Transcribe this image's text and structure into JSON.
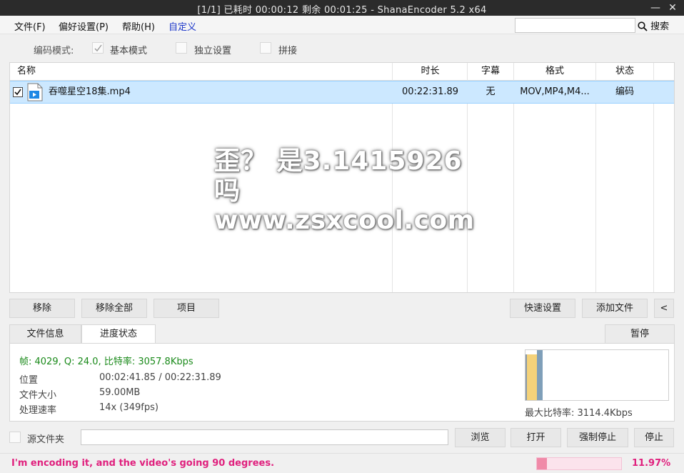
{
  "window": {
    "title": "[1/1] 已耗时 00:00:12  剩余 00:01:25 - ShanaEncoder 5.2 x64",
    "minimize_glyph": "—",
    "close_glyph": "✕"
  },
  "menu": {
    "items": [
      "文件(F)",
      "偏好设置(P)",
      "帮助(H)",
      "自定义"
    ],
    "search_placeholder": "",
    "search_label": "搜索"
  },
  "mode": {
    "label": "编码模式:",
    "options": [
      {
        "label": "基本模式",
        "checked": true
      },
      {
        "label": "独立设置",
        "checked": false
      },
      {
        "label": "拼接",
        "checked": false
      }
    ]
  },
  "file_list": {
    "columns": [
      "名称",
      "时长",
      "字幕",
      "格式",
      "状态"
    ],
    "rows": [
      {
        "checked": true,
        "name": "吞噬星空18集.mp4",
        "duration": "00:22:31.89",
        "subtitle": "无",
        "format": "MOV,MP4,M4...",
        "status": "编码"
      }
    ]
  },
  "watermark": {
    "line1": "歪？ 是3.1415926吗",
    "line2": "www.zsxcool.com"
  },
  "list_buttons": {
    "remove": "移除",
    "remove_all": "移除全部",
    "item": "项目",
    "quick_settings": "快速设置",
    "add_file": "添加文件",
    "collapse": "<"
  },
  "tabs": {
    "file_info": "文件信息",
    "progress": "进度状态",
    "pause": "暂停",
    "active": "progress"
  },
  "progress": {
    "stat_line": "帧: 4029, Q: 24.0, 比特率: 3057.8Kbps",
    "rows": [
      {
        "key": "位置",
        "value": "00:02:41.85 / 00:22:31.89"
      },
      {
        "key": "文件大小",
        "value": "59.00MB"
      },
      {
        "key": "处理速率",
        "value": "14x (349fps)"
      }
    ],
    "max_bitrate": "最大比特率: 3114.4Kbps",
    "graph_fill_fraction": 0.1197
  },
  "bottom": {
    "source_folder_label": "源文件夹",
    "source_folder_value": "",
    "browse": "浏览",
    "open": "打开",
    "force_stop": "强制停止",
    "stop": "停止"
  },
  "status": {
    "message": "I'm encoding it, and the video's going 90 degrees.",
    "percent_text": "11.97%",
    "percent": 11.97,
    "accent": "#e0217e"
  }
}
